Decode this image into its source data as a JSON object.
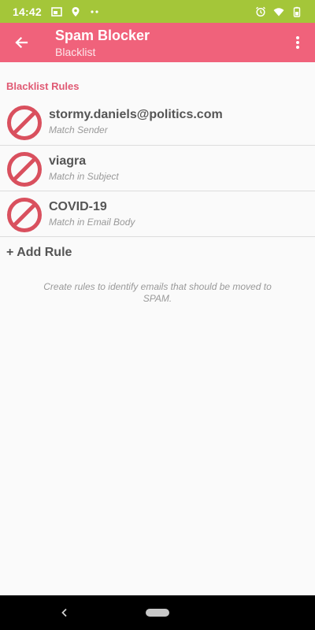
{
  "status_bar": {
    "time": "14:42",
    "icons_left": [
      "gallery-icon",
      "location-icon",
      "more-dots-icon"
    ],
    "icons_right": [
      "alarm-icon",
      "wifi-icon",
      "battery-icon"
    ],
    "color": "#a4c639"
  },
  "app_bar": {
    "title": "Spam Blocker",
    "subtitle": "Blacklist",
    "color": "#f0627b"
  },
  "section": {
    "header": "Blacklist Rules"
  },
  "rules": [
    {
      "title": "stormy.daniels@politics.com",
      "subtitle": "Match Sender"
    },
    {
      "title": "viagra",
      "subtitle": "Match in Subject"
    },
    {
      "title": "COVID-19",
      "subtitle": "Match in Email Body"
    }
  ],
  "actions": {
    "add_rule": "+ Add Rule"
  },
  "help": {
    "text": "Create rules to identify emails that should be moved to SPAM."
  },
  "colors": {
    "accent": "#e05a74",
    "block_icon": "#d9505e"
  }
}
